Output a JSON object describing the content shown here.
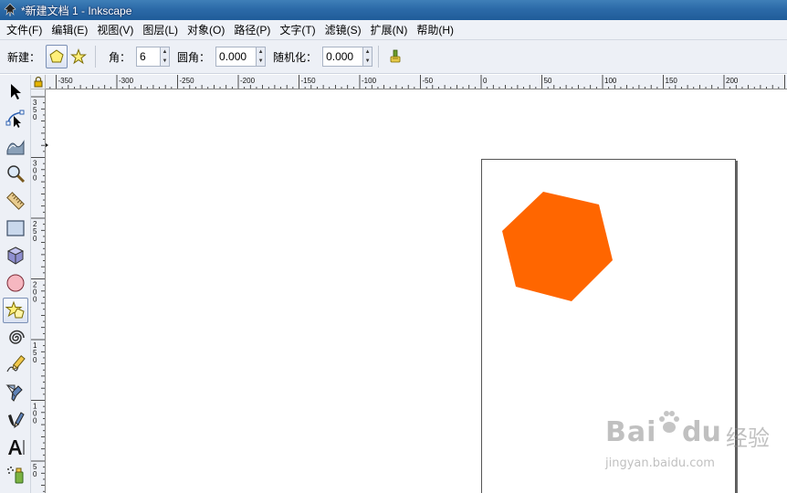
{
  "window": {
    "title": "*新建文档 1 - Inkscape"
  },
  "menu": {
    "items": [
      {
        "label": "文件(F)"
      },
      {
        "label": "编辑(E)"
      },
      {
        "label": "视图(V)"
      },
      {
        "label": "图层(L)"
      },
      {
        "label": "对象(O)"
      },
      {
        "label": "路径(P)"
      },
      {
        "label": "文字(T)"
      },
      {
        "label": "滤镜(S)"
      },
      {
        "label": "扩展(N)"
      },
      {
        "label": "帮助(H)"
      }
    ]
  },
  "tool_controls": {
    "new_label": "新建：",
    "corners_label": "角：",
    "corners_value": "6",
    "rounded_label": "圆角：",
    "rounded_value": "0.000",
    "randomized_label": "随机化：",
    "randomized_value": "0.000"
  },
  "ruler": {
    "h_labels": [
      "-350",
      "-300",
      "-250",
      "-200",
      "-150",
      "-100",
      "-50",
      "0",
      "50",
      "100",
      "150",
      "200"
    ],
    "v_labels": [
      "350",
      "300",
      "250",
      "200",
      "150",
      "100",
      "50"
    ]
  },
  "toolbox": {
    "tools": [
      {
        "name": "selector-tool",
        "icon": "arrow-icon"
      },
      {
        "name": "node-tool",
        "icon": "node-icon"
      },
      {
        "name": "tweak-tool",
        "icon": "tweak-icon"
      },
      {
        "name": "zoom-tool",
        "icon": "magnifier-icon"
      },
      {
        "name": "measure-tool",
        "icon": "ruler-icon"
      },
      {
        "name": "rectangle-tool",
        "icon": "rectangle-icon"
      },
      {
        "name": "3d-box-tool",
        "icon": "box-icon"
      },
      {
        "name": "ellipse-tool",
        "icon": "circle-icon"
      },
      {
        "name": "star-tool",
        "icon": "star-icon",
        "active": true
      },
      {
        "name": "spiral-tool",
        "icon": "spiral-icon"
      },
      {
        "name": "pencil-tool",
        "icon": "pencil-icon"
      },
      {
        "name": "pen-tool",
        "icon": "pen-icon"
      },
      {
        "name": "calligraphy-tool",
        "icon": "calligraphy-icon"
      },
      {
        "name": "text-tool",
        "icon": "text-icon"
      },
      {
        "name": "spray-tool",
        "icon": "spray-icon"
      }
    ]
  },
  "canvas": {
    "shape_fill": "#ff6600",
    "shape_type": "hexagon"
  },
  "watermark": {
    "brand": "Bai",
    "brand_suffix": "du",
    "cn": "经验",
    "url": "jingyan.baidu.com"
  }
}
